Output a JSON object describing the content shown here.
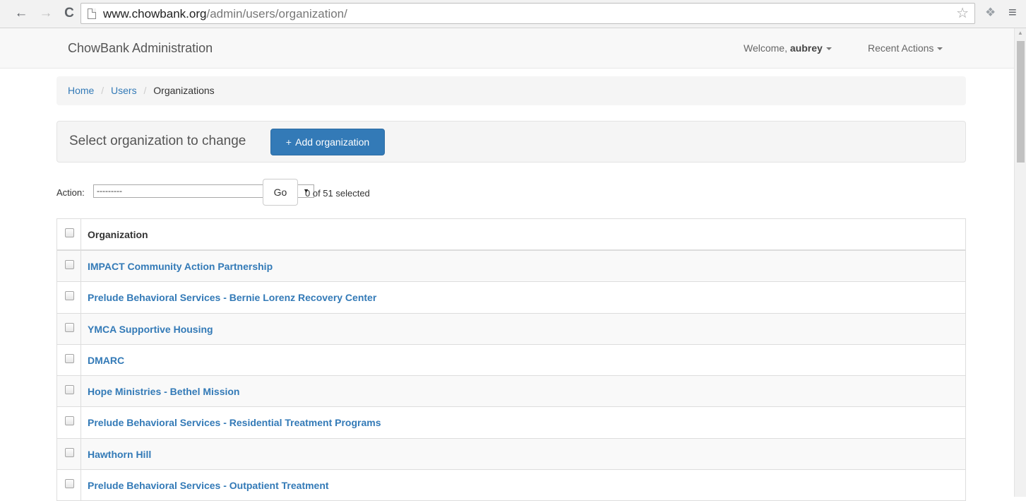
{
  "browser": {
    "url_host": "www.chowbank.org",
    "url_path": "/admin/users/organization/",
    "back_glyph": "←",
    "forward_glyph": "→",
    "reload_glyph": "C",
    "star_glyph": "☆",
    "ext_glyph": "❖",
    "menu_glyph": "≡"
  },
  "navbar": {
    "brand": "ChowBank Administration",
    "welcome_prefix": "Welcome,",
    "username": "aubrey",
    "recent_actions": "Recent Actions"
  },
  "breadcrumb": {
    "items": [
      "Home",
      "Users",
      "Organizations"
    ],
    "separator": "/"
  },
  "header": {
    "title": "Select organization to change",
    "add_button_plus": "+",
    "add_button_label": "Add organization"
  },
  "actions": {
    "label": "Action:",
    "selected_option": "---------",
    "select_arrow": "▼",
    "go_label": "Go",
    "selection_count": "0 of 51 selected"
  },
  "table": {
    "column_header": "Organization",
    "rows": [
      "IMPACT Community Action Partnership",
      "Prelude Behavioral Services - Bernie Lorenz Recovery Center",
      "YMCA Supportive Housing",
      "DMARC",
      "Hope Ministries - Bethel Mission",
      "Prelude Behavioral Services - Residential Treatment Programs",
      "Hawthorn Hill",
      "Prelude Behavioral Services - Outpatient Treatment"
    ]
  },
  "colors": {
    "link": "#337ab7",
    "primary_button": "#337ab7"
  }
}
